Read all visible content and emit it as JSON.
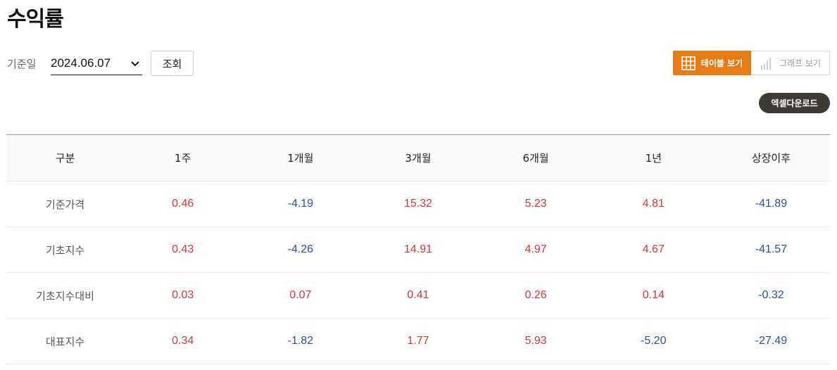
{
  "page": {
    "title": "수익률"
  },
  "filter": {
    "date_label": "기준일",
    "date_value": "2024.06.07",
    "search_label": "조회"
  },
  "view_toggle": {
    "table_label": "테이블 보기",
    "graph_label": "그래프 보기",
    "active": "table"
  },
  "excel_label": "엑셀다운로드",
  "colors": {
    "accent": "#e57b13",
    "positive": "#d23a3a",
    "negative": "#2f4f9e",
    "dark_button": "#3d3935"
  },
  "table": {
    "headers": [
      "구분",
      "1주",
      "1개월",
      "3개월",
      "6개월",
      "1년",
      "상장이후"
    ],
    "rows": [
      {
        "label": "기준가격",
        "values": [
          "0.46",
          "-4.19",
          "15.32",
          "5.23",
          "4.81",
          "-41.89"
        ]
      },
      {
        "label": "기초지수",
        "values": [
          "0.43",
          "-4.26",
          "14.91",
          "4.97",
          "4.67",
          "-41.57"
        ]
      },
      {
        "label": "기초지수대비",
        "values": [
          "0.03",
          "0.07",
          "0.41",
          "0.26",
          "0.14",
          "-0.32"
        ]
      },
      {
        "label": "대표지수",
        "values": [
          "0.34",
          "-1.82",
          "1.77",
          "5.93",
          "-5.20",
          "-27.49"
        ]
      }
    ]
  }
}
